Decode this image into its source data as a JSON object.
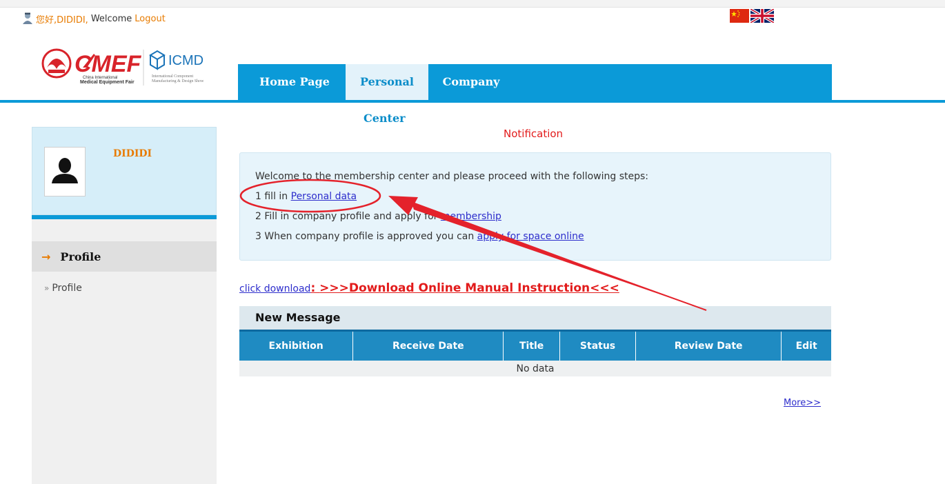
{
  "topbar": {
    "greeting_cn": "您好,DIDIDI,",
    "welcome": "Welcome",
    "logout": "Logout"
  },
  "logo": {
    "cmef_name": "CMEF",
    "cmef_sub1": "China International",
    "cmef_sub2": "Medical Equipment Fair",
    "icmd_name": "ICMD",
    "icmd_sub1": "International Component",
    "icmd_sub2": "Manufacturing & Design Show"
  },
  "nav": {
    "items": [
      {
        "label": "Home Page"
      },
      {
        "label": "Personal"
      },
      {
        "label": "Company"
      }
    ],
    "center_label": "Center"
  },
  "sidebar": {
    "username": "DIDIDI",
    "section_label": "Profile",
    "link_label": "Profile"
  },
  "notification": {
    "title": "Notification",
    "intro": "Welcome to the membership center and please proceed with the following steps:",
    "step1_prefix": "1 fill in ",
    "step1_link": "Personal data",
    "step2_prefix": "2 Fill in company profile and apply for ",
    "step2_link": "membership",
    "step3_prefix": "3 When company profile is approved you can ",
    "step3_link": "apply for space online"
  },
  "download": {
    "lead": "click download",
    "colon": ": ",
    "link": ">>>Download Online Manual Instruction<<<"
  },
  "messages": {
    "title": "New Message",
    "columns": [
      "Exhibition",
      "Receive Date",
      "Title",
      "Status",
      "Review Date",
      "Edit"
    ],
    "empty_text": "No data",
    "more": "More>>"
  },
  "colors": {
    "nav_blue": "#0b9ad8",
    "orange": "#e87b00",
    "red": "#e21b1b",
    "link_blue": "#2d2dcc"
  }
}
